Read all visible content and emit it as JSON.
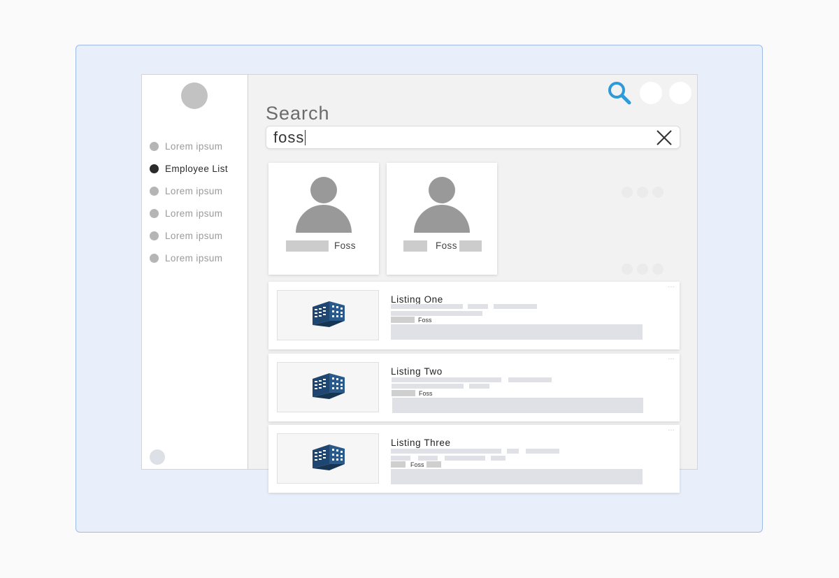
{
  "sidebar": {
    "items": [
      {
        "label": "Lorem ipsum",
        "active": false
      },
      {
        "label": "Employee List",
        "active": true
      },
      {
        "label": "Lorem ipsum",
        "active": false
      },
      {
        "label": "Lorem ipsum",
        "active": false
      },
      {
        "label": "Lorem ipsum",
        "active": false
      },
      {
        "label": "Lorem ipsum",
        "active": false
      }
    ]
  },
  "header": {
    "search_icon": "search-icon",
    "accent_color": "#2e9ad8"
  },
  "main": {
    "title": "Search",
    "search": {
      "value": "foss"
    },
    "people": [
      {
        "name": "Foss"
      },
      {
        "name": "Foss"
      }
    ],
    "listings": [
      {
        "title": "Listing One",
        "tag": "Foss",
        "icon": "building-icon"
      },
      {
        "title": "Listing Two",
        "tag": "Foss",
        "icon": "building-icon"
      },
      {
        "title": "Listing Three",
        "tag": "Foss",
        "icon": "building-icon"
      }
    ],
    "more_glyph": "…"
  },
  "colors": {
    "frame_bg": "#e8effb",
    "building": "#1f4670"
  }
}
